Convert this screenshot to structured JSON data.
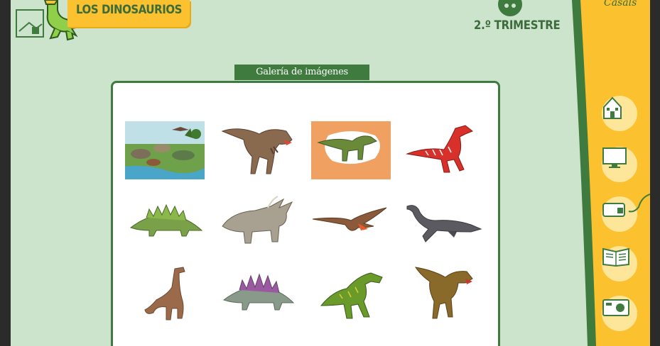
{
  "header": {
    "title": "LOS DINOSAURIOS",
    "term": "2.º TRIMESTRE",
    "publisher": "Casals"
  },
  "gallery": {
    "label": "Galería de imágenes",
    "items": [
      {
        "name": "dinosaur-scene",
        "selected": false
      },
      {
        "name": "tyrannosaurus",
        "selected": false
      },
      {
        "name": "iguanodon",
        "selected": true
      },
      {
        "name": "velociraptor",
        "selected": false
      },
      {
        "name": "stegosaurus-green",
        "selected": false
      },
      {
        "name": "triceratops",
        "selected": false
      },
      {
        "name": "pterodactyl",
        "selected": false
      },
      {
        "name": "plesiosaur",
        "selected": false
      },
      {
        "name": "brachiosaurus",
        "selected": false
      },
      {
        "name": "stegosaurus-purple",
        "selected": false
      },
      {
        "name": "allosaurus",
        "selected": false
      },
      {
        "name": "carnotaurus",
        "selected": false
      }
    ]
  },
  "sidebar": {
    "buttons": [
      {
        "icon": "home-icon"
      },
      {
        "icon": "monitor-icon"
      },
      {
        "icon": "mouse-icon"
      },
      {
        "icon": "book-icon"
      },
      {
        "icon": "camera-icon"
      }
    ]
  },
  "colors": {
    "background": "#cce3cc",
    "accent_green": "#3f7a3f",
    "yellow": "#fbc12e",
    "selected_tile": "#f0a060"
  }
}
